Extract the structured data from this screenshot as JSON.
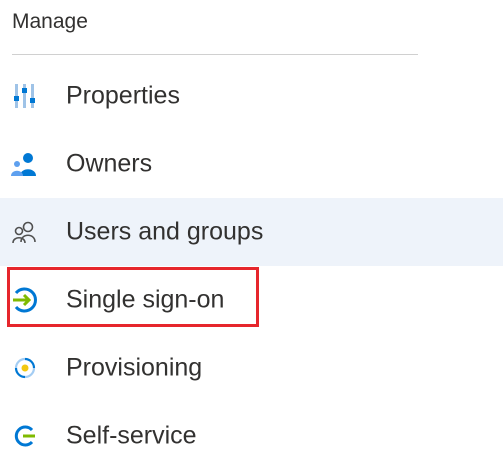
{
  "section": {
    "title": "Manage"
  },
  "menu": {
    "items": [
      {
        "label": "Properties",
        "icon": "properties-icon"
      },
      {
        "label": "Owners",
        "icon": "owners-icon"
      },
      {
        "label": "Users and groups",
        "icon": "users-groups-icon",
        "state": "hovered"
      },
      {
        "label": "Single sign-on",
        "icon": "single-sign-on-icon",
        "state": "highlighted"
      },
      {
        "label": "Provisioning",
        "icon": "provisioning-icon"
      },
      {
        "label": "Self-service",
        "icon": "self-service-icon"
      }
    ]
  },
  "colors": {
    "hover_bg": "#eef3fa",
    "highlight_border": "#e6262c",
    "icon_blue": "#0078d4",
    "icon_green": "#7fba00",
    "text": "#323130"
  }
}
